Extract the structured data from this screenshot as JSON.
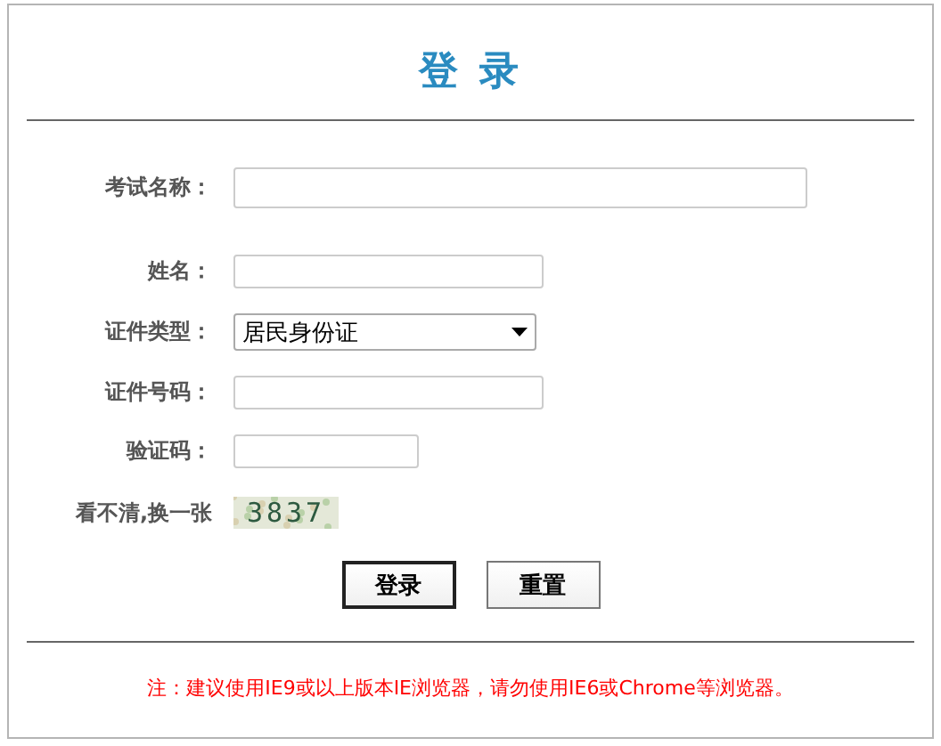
{
  "title": "登 录",
  "fields": [
    {
      "kind": "text",
      "label": "考试名称："
    },
    {
      "kind": "text",
      "label": "姓名："
    },
    {
      "kind": "select",
      "label": "证件类型：",
      "value": "居民身份证"
    },
    {
      "kind": "text",
      "label": "证件号码："
    },
    {
      "kind": "text",
      "label": "验证码："
    }
  ],
  "captcha": {
    "link": "看不清,换一张",
    "code": "3837"
  },
  "buttons": [
    {
      "label": "登录",
      "default": true
    },
    {
      "label": "重置",
      "default": false
    }
  ],
  "note": "注：建议使用IE9或以上版本IE浏览器，请勿使用IE6或Chrome等浏览器。"
}
